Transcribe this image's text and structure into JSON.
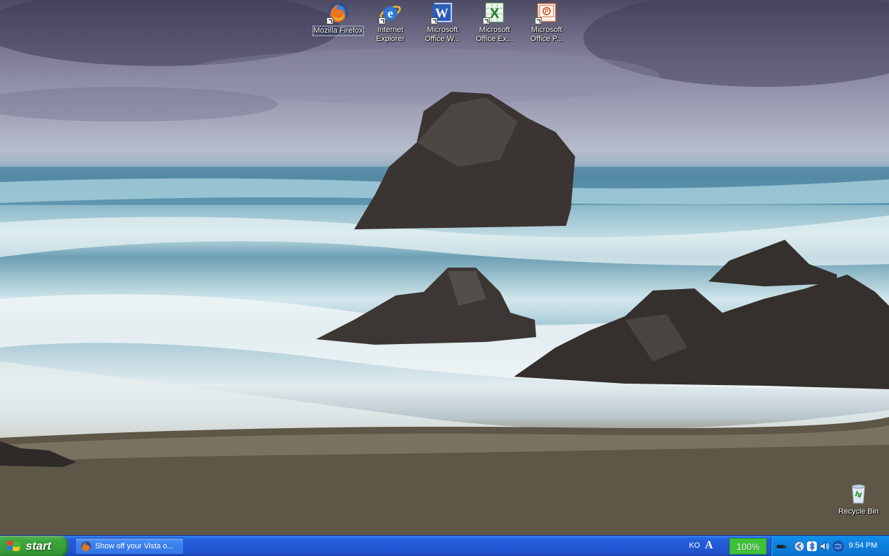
{
  "desktop": {
    "icons": [
      {
        "label": "Mozilla Firefox",
        "icon": "firefox-icon"
      },
      {
        "label": "Internet\nExplorer",
        "icon": "internet-explorer-icon"
      },
      {
        "label": "Microsoft\nOffice W...",
        "icon": "word-icon"
      },
      {
        "label": "Microsoft\nOffice Ex...",
        "icon": "excel-icon"
      },
      {
        "label": "Microsoft\nOffice P...",
        "icon": "powerpoint-icon"
      }
    ],
    "recycle_bin": {
      "label": "Recycle Bin",
      "icon": "recycle-bin-icon"
    }
  },
  "taskbar": {
    "start_label": "start",
    "task_button": {
      "label": "Show off your Vista o...",
      "icon": "firefox-icon"
    },
    "language": "KO",
    "ime_indicator": "A",
    "zoom": "100%",
    "tray_icons": [
      "power-plug-icon",
      "network-back-icon",
      "bluetooth-icon",
      "volume-icon",
      "globe-icon"
    ],
    "clock": "9:54 PM"
  },
  "colors": {
    "taskbar_blue": "#245edb",
    "start_green": "#3ca83e",
    "tray_blue": "#0f84e2",
    "zoom_green": "#3ec23a"
  }
}
